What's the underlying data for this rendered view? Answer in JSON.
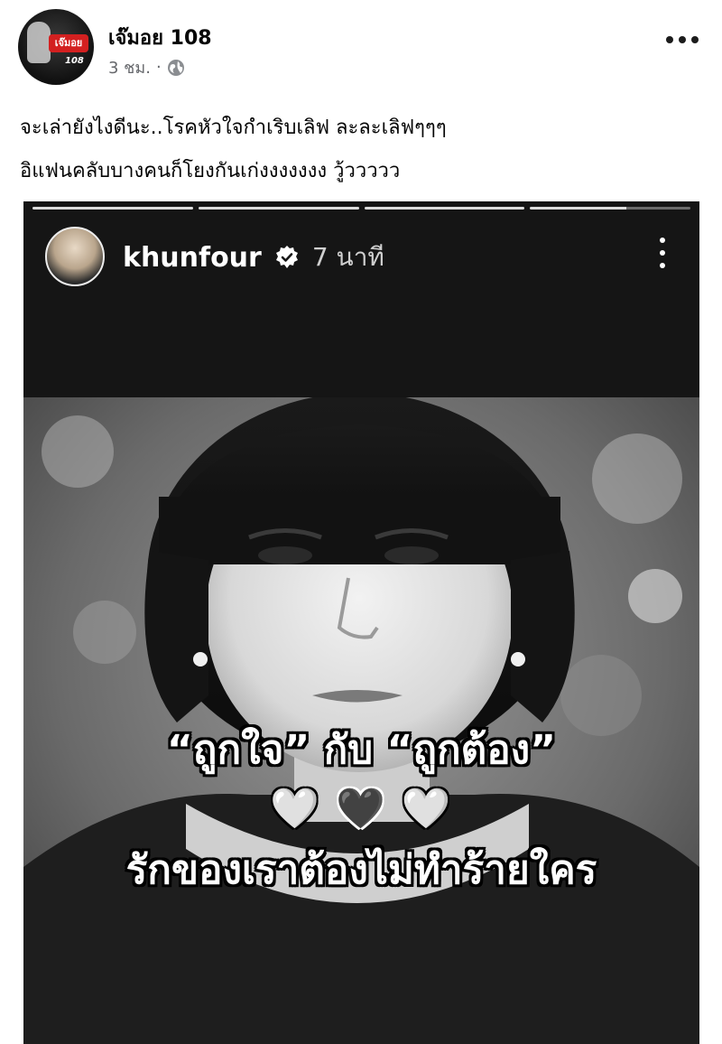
{
  "post": {
    "page_name": "เจ๊มอย 108",
    "timestamp": "3 ชม.",
    "separator": "·",
    "privacy_icon": "globe-icon",
    "avatar_badge_text": "เจ๊มอย",
    "avatar_badge_number": "108",
    "text_lines": [
      "จะเล่ายังไงดีนะ..โรคหัวใจกำเริบเลิฟ ละละเลิฟๆๆๆ",
      "อิแฟนคลับบางคนก็โยงกันเก่งงงงงงง วู้ววววว"
    ]
  },
  "story": {
    "username": "khunfour",
    "verified_icon": "verified-badge-icon",
    "time": "7 นาที",
    "progress_segments": 4,
    "caption_line_1": "“ถูกใจ” กับ “ถูกต้อง”",
    "hearts": [
      "🤍",
      "🖤",
      "🤍"
    ],
    "caption_line_2": "รักของเราต้องไม่ทำร้ายใคร"
  },
  "colors": {
    "text_primary": "#050505",
    "text_secondary": "#65676b",
    "story_bg": "#151515"
  }
}
